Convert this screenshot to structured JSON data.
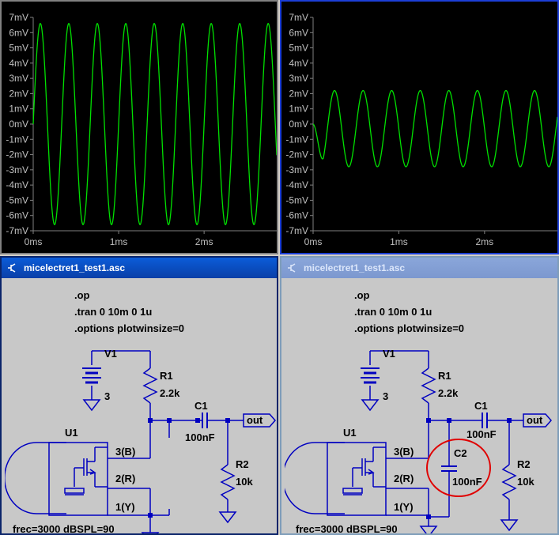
{
  "plots": [
    {
      "id": "left",
      "y_labels": [
        "7mV",
        "6mV",
        "5mV",
        "4mV",
        "3mV",
        "2mV",
        "1mV",
        "0mV",
        "-1mV",
        "-2mV",
        "-3mV",
        "-4mV",
        "-5mV",
        "-6mV",
        "-7mV"
      ],
      "x_labels": [
        "0ms",
        "1ms",
        "2ms"
      ],
      "chart_data": {
        "type": "line",
        "ylim": [
          -7,
          7
        ],
        "xlim": [
          0,
          2.85
        ],
        "series": [
          {
            "frequency_khz": 3,
            "amplitude_mv": 6.6,
            "offset_mv": 0,
            "phase": "sine",
            "color": "#00e000"
          }
        ]
      }
    },
    {
      "id": "right",
      "y_labels": [
        "7mV",
        "6mV",
        "5mV",
        "4mV",
        "3mV",
        "2mV",
        "1mV",
        "0mV",
        "-1mV",
        "-2mV",
        "-3mV",
        "-4mV",
        "-5mV",
        "-6mV",
        "-7mV"
      ],
      "x_labels": [
        "0ms",
        "1ms",
        "2ms"
      ],
      "chart_data": {
        "type": "line",
        "ylim": [
          -7,
          7
        ],
        "xlim": [
          0,
          2.85
        ],
        "series": [
          {
            "frequency_khz": 3,
            "amplitude_mv": 2.5,
            "offset_mv": -0.3,
            "phase": "neg-sine",
            "color": "#00e000"
          }
        ]
      }
    }
  ],
  "windows": [
    {
      "id": "left",
      "title": "micelectret1_test1.asc",
      "directives": [
        ".op",
        ".tran 0 10m 0 1u",
        ".options plotwinsize=0"
      ],
      "v1": "V1",
      "v1_value": "3",
      "r1": "R1",
      "r1_value": "2.2k",
      "c1": "C1",
      "c1_value": "100nF",
      "r2": "R2",
      "r2_value": "10k",
      "u1": "U1",
      "pin_b": "3(B)",
      "pin_r": "2(R)",
      "pin_y": "1(Y)",
      "out": "out",
      "params": "frec=3000 dBSPL=90"
    },
    {
      "id": "right",
      "title": "micelectret1_test1.asc",
      "directives": [
        ".op",
        ".tran 0 10m 0 1u",
        ".options plotwinsize=0"
      ],
      "v1": "V1",
      "v1_value": "3",
      "r1": "R1",
      "r1_value": "2.2k",
      "c1": "C1",
      "c1_value": "100nF",
      "c2": "C2",
      "c2_value": "100nF",
      "r2": "R2",
      "r2_value": "10k",
      "u1": "U1",
      "pin_b": "3(B)",
      "pin_r": "2(R)",
      "pin_y": "1(Y)",
      "out": "out",
      "params": "frec=3000 dBSPL=90",
      "highlight_color": "#e00000"
    }
  ]
}
